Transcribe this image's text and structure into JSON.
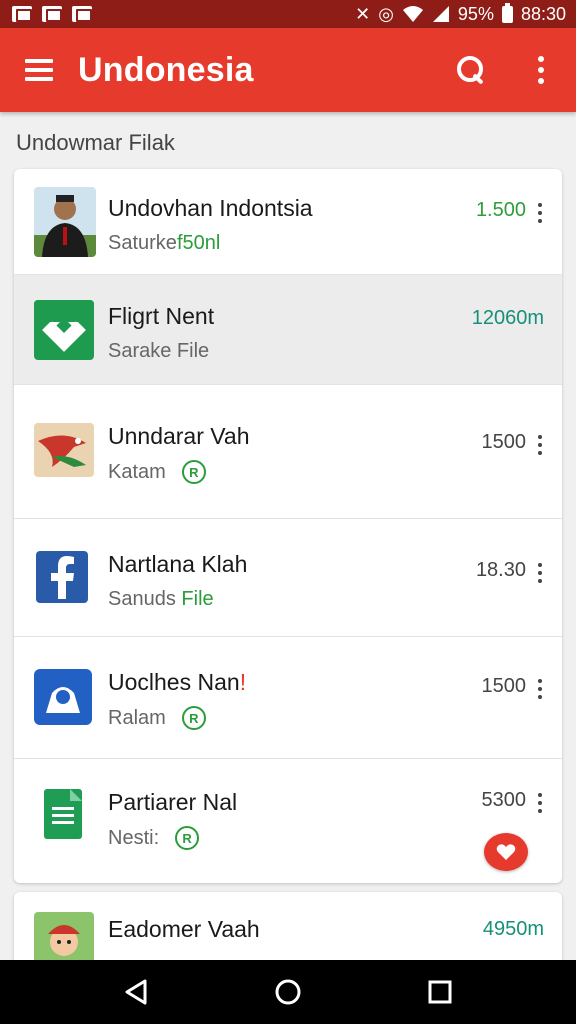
{
  "status_bar": {
    "battery": "95%",
    "time": "88:30"
  },
  "app_bar": {
    "title": "Undonesia"
  },
  "section": {
    "header": "Undowmar Filak"
  },
  "items": [
    {
      "title": "Undovhan Indontsia",
      "subtitle_prefix": "Saturke",
      "subtitle_green": "f50nl",
      "value": "1.500",
      "value_color": "green",
      "icon": "person-photo-icon"
    },
    {
      "title": "Fligrt Nent",
      "subtitle_prefix": "Sarake File",
      "subtitle_green": "",
      "value": "12060m",
      "value_color": "teal",
      "icon": "green-app-icon"
    },
    {
      "title": "Unndarar Vah",
      "subtitle_prefix": "Katam",
      "subtitle_green": "",
      "value": "1500",
      "value_color": "gray",
      "icon": "flag-bird-icon"
    },
    {
      "title": "Nartlana Klah",
      "subtitle_prefix": "Sanuds",
      "subtitle_green": "File",
      "value": "18.30",
      "value_color": "gray",
      "icon": "facebook-icon"
    },
    {
      "title": "Uoclhes Nan",
      "title_accent": "!",
      "subtitle_prefix": "Ralam",
      "subtitle_green": "",
      "value": "1500",
      "value_color": "gray",
      "icon": "blue-app-icon"
    },
    {
      "title": "Partiarer Nal",
      "subtitle_prefix": "Nesti:",
      "subtitle_green": "",
      "value": "5300",
      "value_color": "gray",
      "icon": "sheets-icon"
    },
    {
      "title": "Eadomer Vaah",
      "subtitle_prefix": "",
      "subtitle_green": "",
      "value": "4950m",
      "value_color": "teal",
      "icon": "cartoon-avatar-icon"
    }
  ],
  "colors": {
    "app_bar": "#e53a2c",
    "status_bar": "#8e1d17",
    "green": "#2e9e39",
    "teal": "#17907a"
  }
}
